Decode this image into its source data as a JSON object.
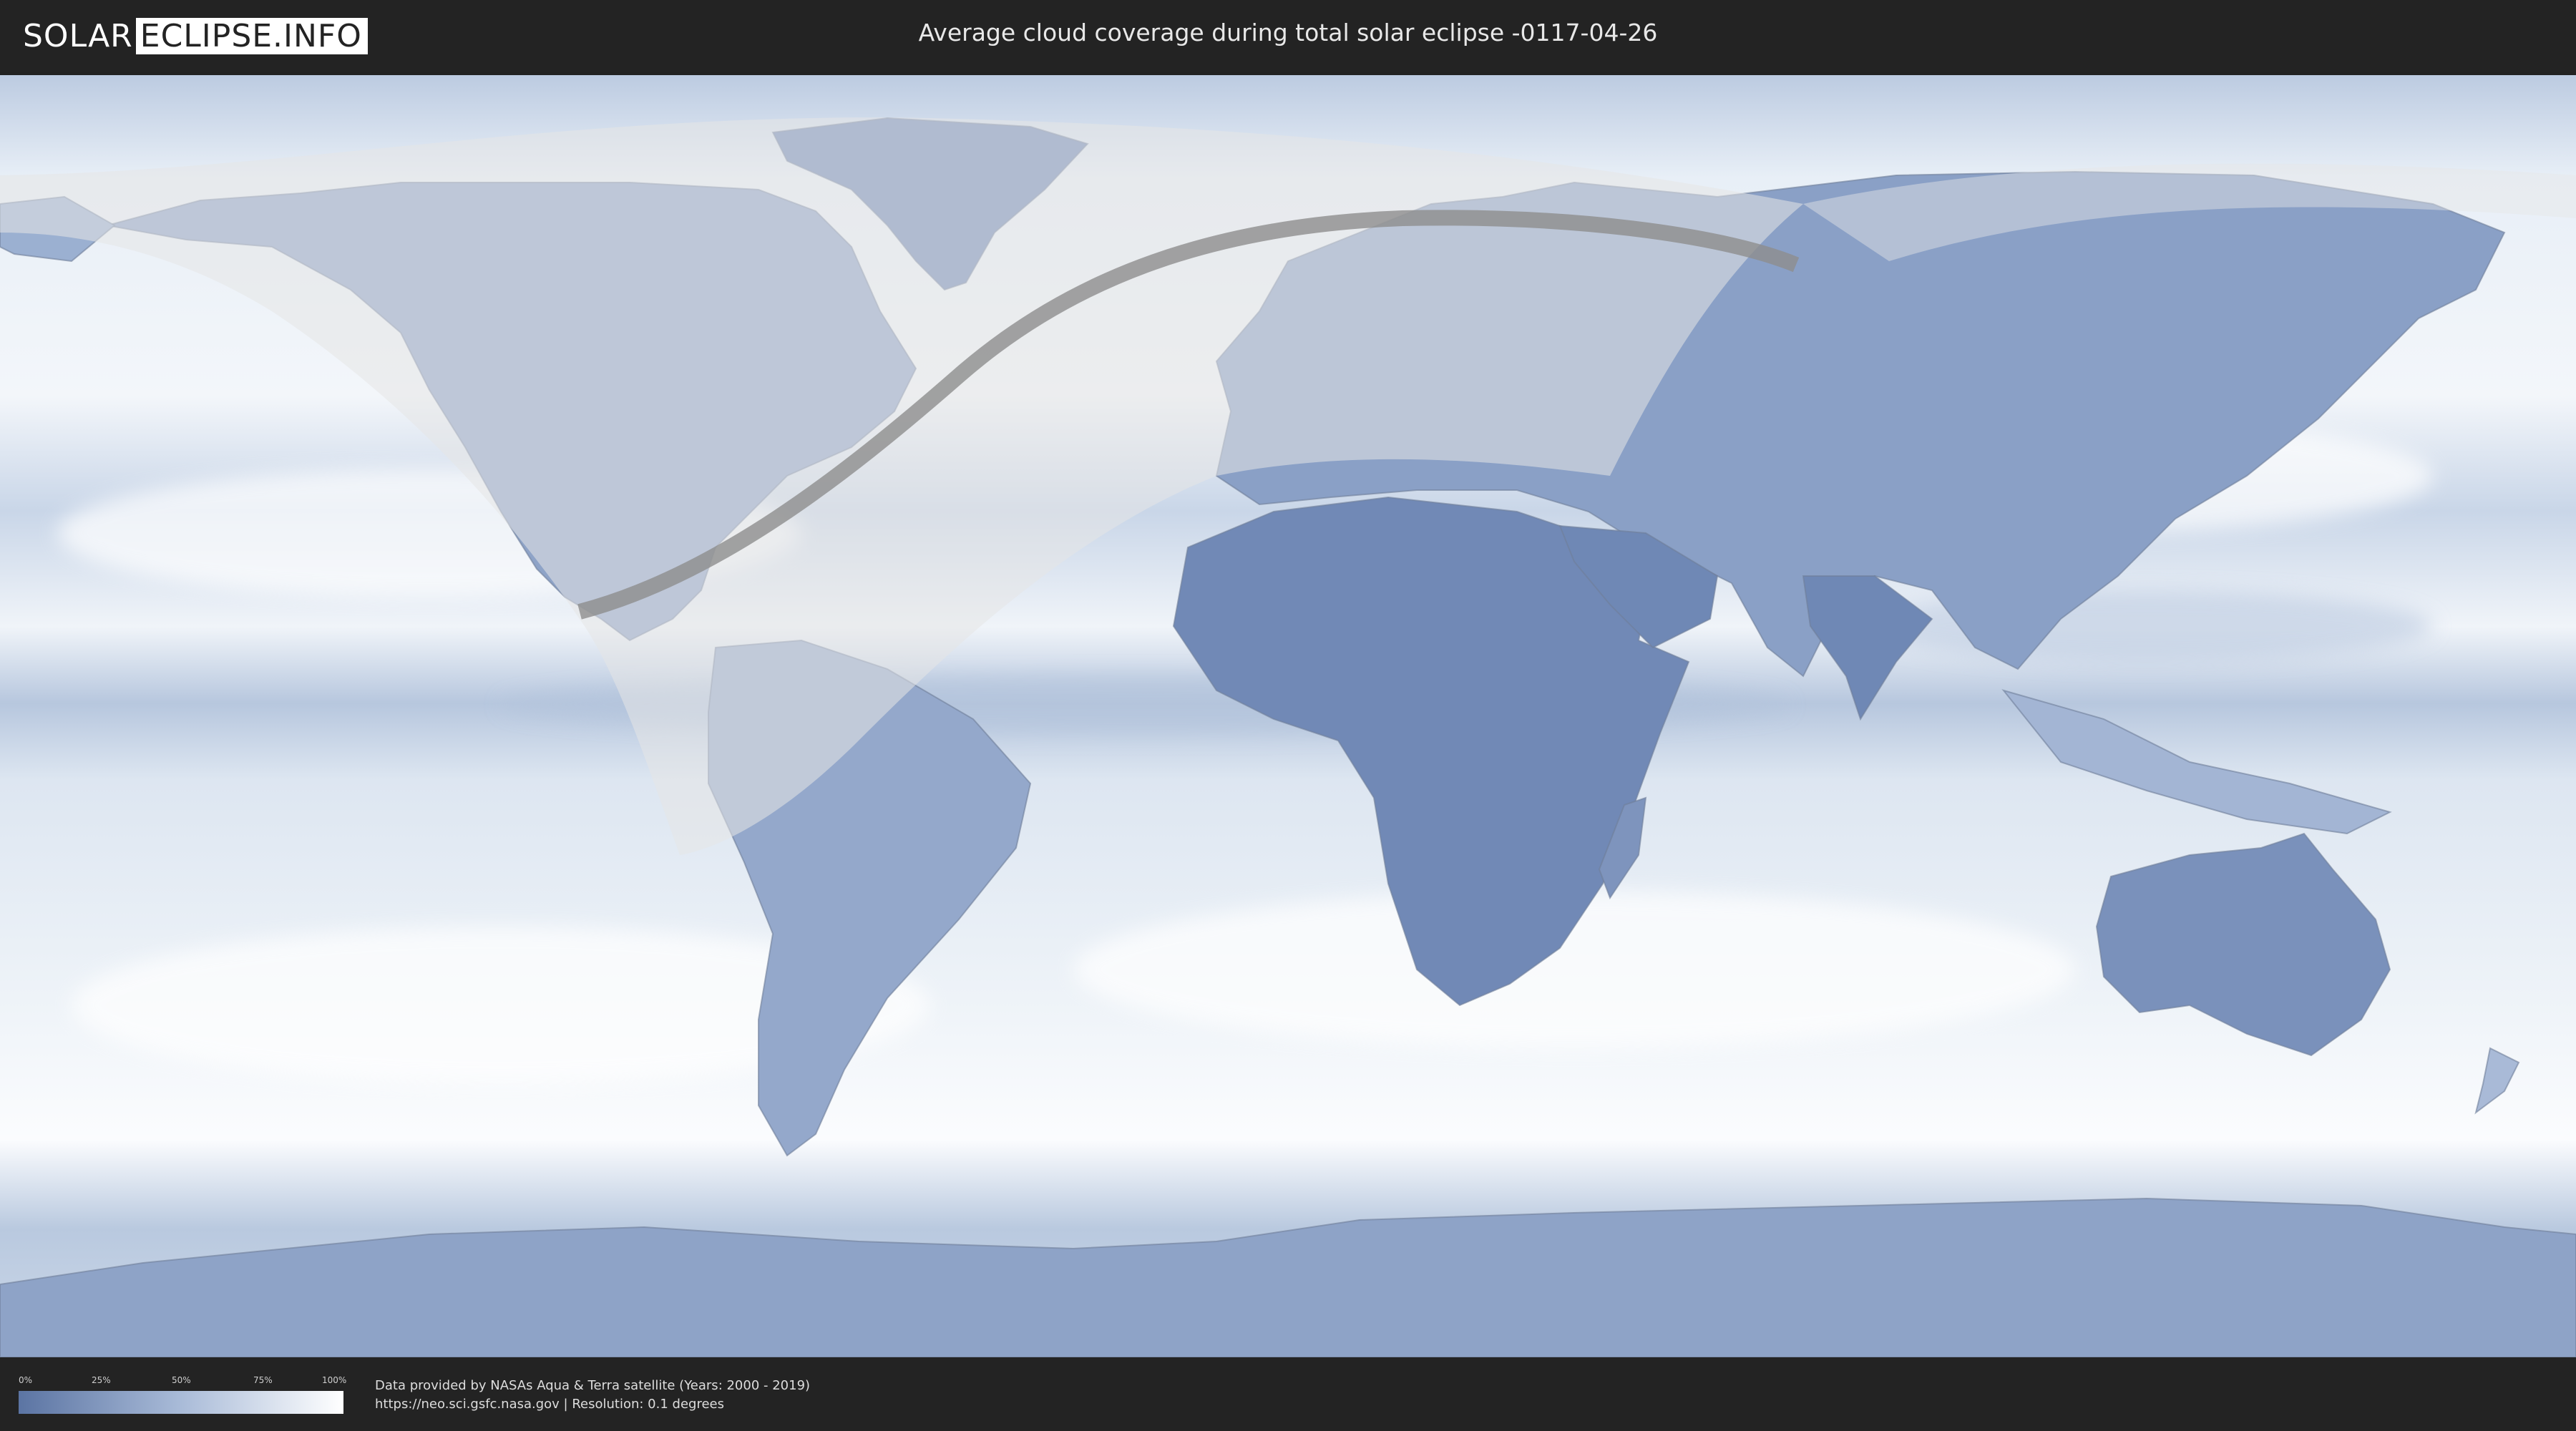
{
  "header": {
    "logo_part1": "SOLAR",
    "logo_part2": "ECLIPSE.INFO",
    "title": "Average cloud coverage during total solar eclipse -0117-04-26"
  },
  "legend": {
    "ticks": [
      "0%",
      "25%",
      "50%",
      "75%",
      "100%"
    ],
    "colors": {
      "min": "#5b74a3",
      "max": "#ffffff"
    }
  },
  "footer": {
    "credit_line1": "Data provided by NASAs Aqua & Terra satellite (Years: 2000 - 2019)",
    "credit_line2": "https://neo.sci.gsfc.nasa.gov | Resolution: 0.1 degrees"
  },
  "map": {
    "projection": "equirectangular",
    "colors": {
      "ocean_clear": "#e9f0f7",
      "land_clear": "#6f88b5",
      "eclipse_path": "#8d8d8d",
      "visibility_overlay": "#e4e4e4"
    }
  }
}
